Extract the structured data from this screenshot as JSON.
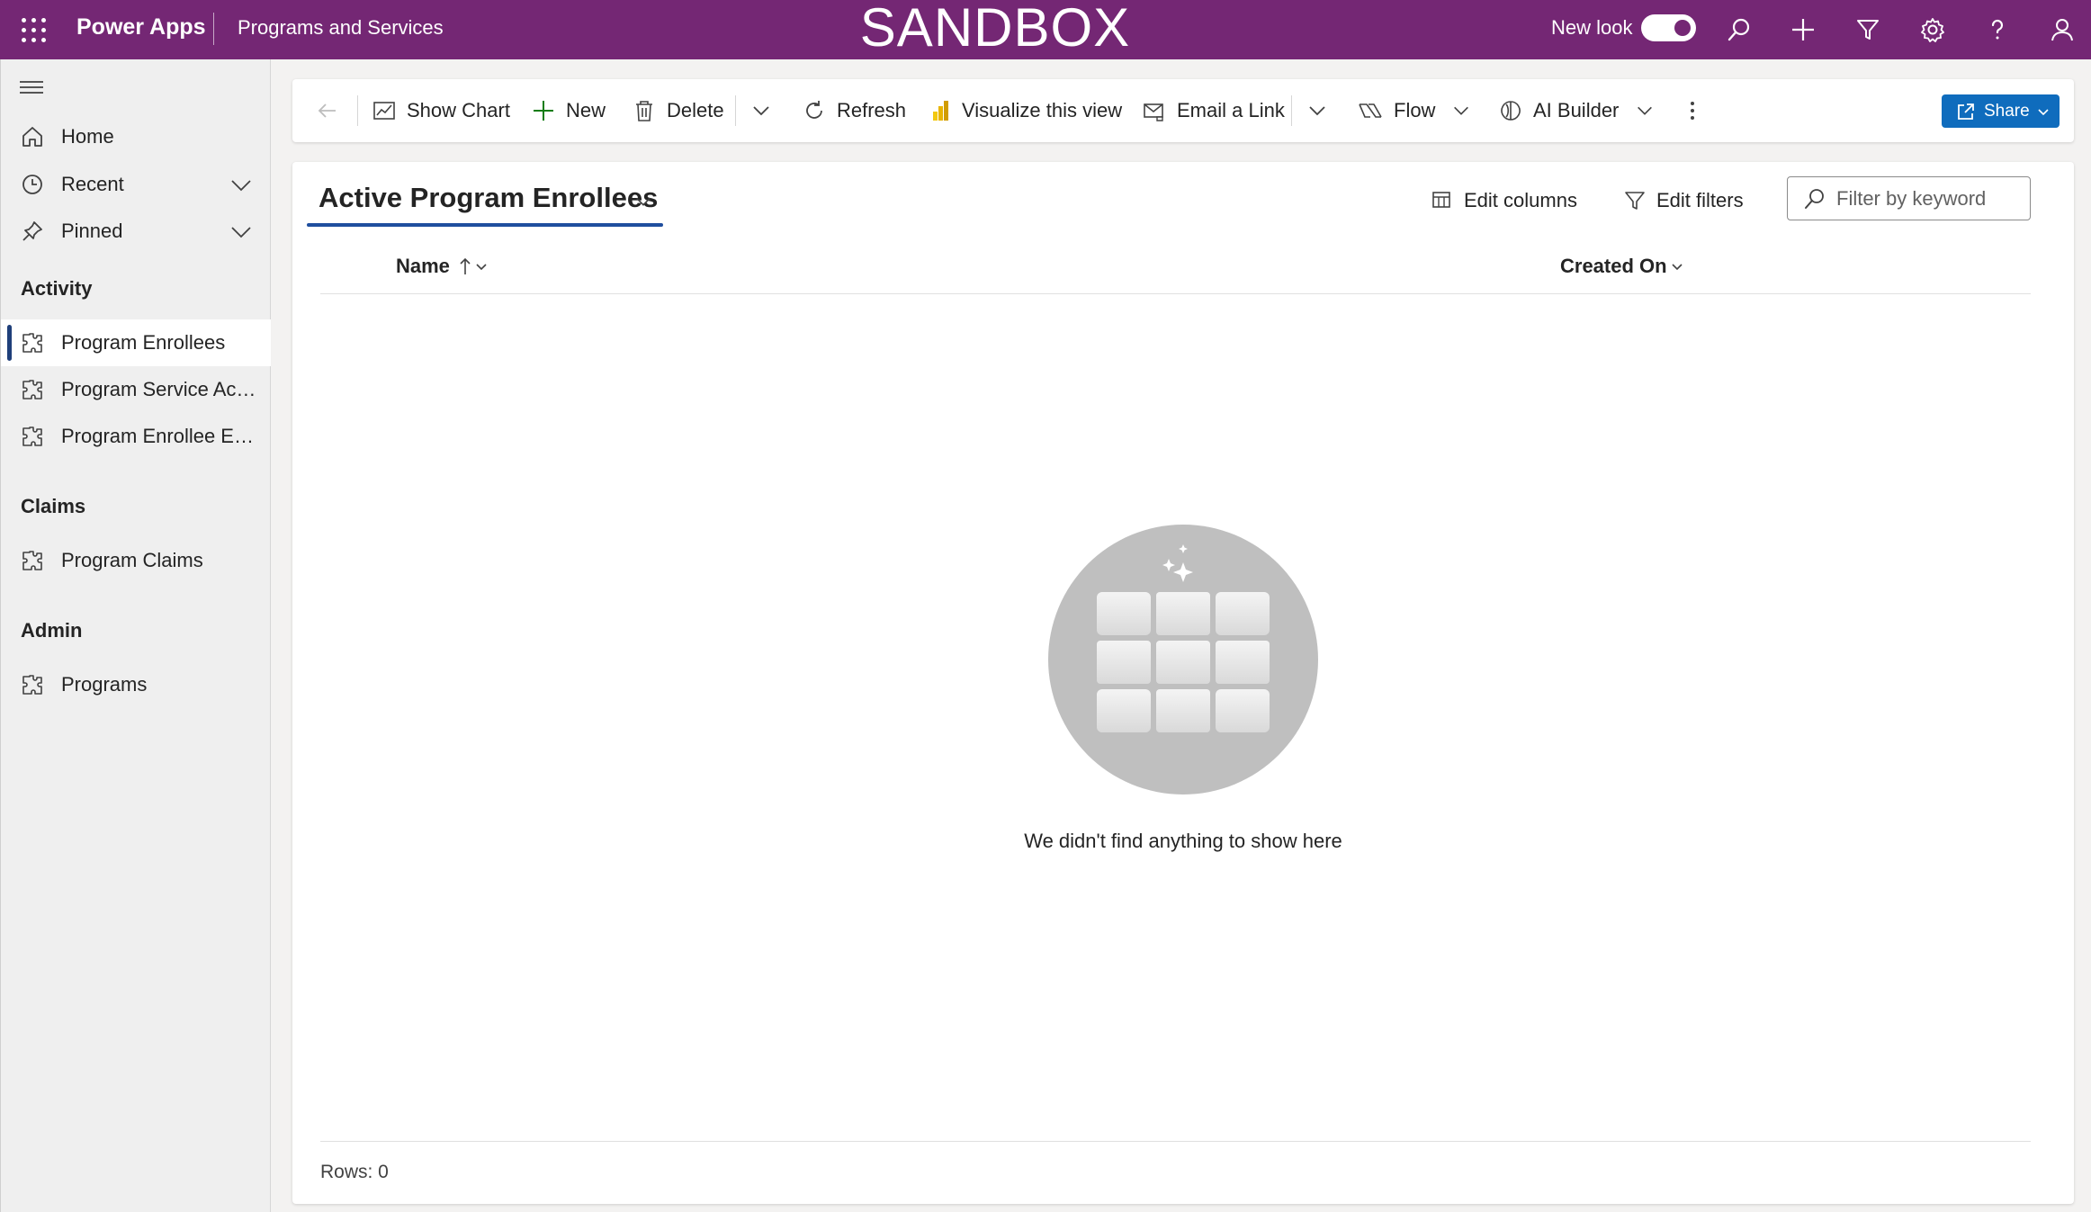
{
  "topbar": {
    "app_name": "Power Apps",
    "environment": "Programs and Services",
    "banner": "SANDBOX",
    "new_look_label": "New look",
    "new_look_enabled": true,
    "icons": [
      "search-icon",
      "plus-icon",
      "filter-icon",
      "gear-icon",
      "help-icon",
      "user-icon"
    ]
  },
  "sidebar": {
    "top_items": [
      {
        "label": "Home",
        "icon": "home-icon"
      },
      {
        "label": "Recent",
        "icon": "clock-icon"
      },
      {
        "label": "Pinned",
        "icon": "pin-icon"
      }
    ],
    "groups": [
      {
        "title": "Activity",
        "items": [
          "Program Enrollees",
          "Program Service Acti...",
          "Program Enrollee Ent..."
        ]
      },
      {
        "title": "Claims",
        "items": [
          "Program Claims"
        ]
      },
      {
        "title": "Admin",
        "items": [
          "Programs"
        ]
      }
    ],
    "selected": "Program Enrollees"
  },
  "commandbar": {
    "show_chart": "Show Chart",
    "new": "New",
    "delete": "Delete",
    "refresh": "Refresh",
    "visualize": "Visualize this view",
    "email_link": "Email a Link",
    "flow": "Flow",
    "ai_builder": "AI Builder",
    "share": "Share"
  },
  "view": {
    "title": "Active Program Enrollees",
    "edit_columns": "Edit columns",
    "edit_filters": "Edit filters",
    "filter_placeholder": "Filter by keyword",
    "columns": [
      "Name",
      "Created On"
    ],
    "empty_message": "We didn't find anything to show here",
    "rows_label": "Rows: 0"
  },
  "colors": {
    "topbar": "#742774",
    "accent": "#0f6cbd",
    "selection_bar": "#1f3f7a"
  }
}
